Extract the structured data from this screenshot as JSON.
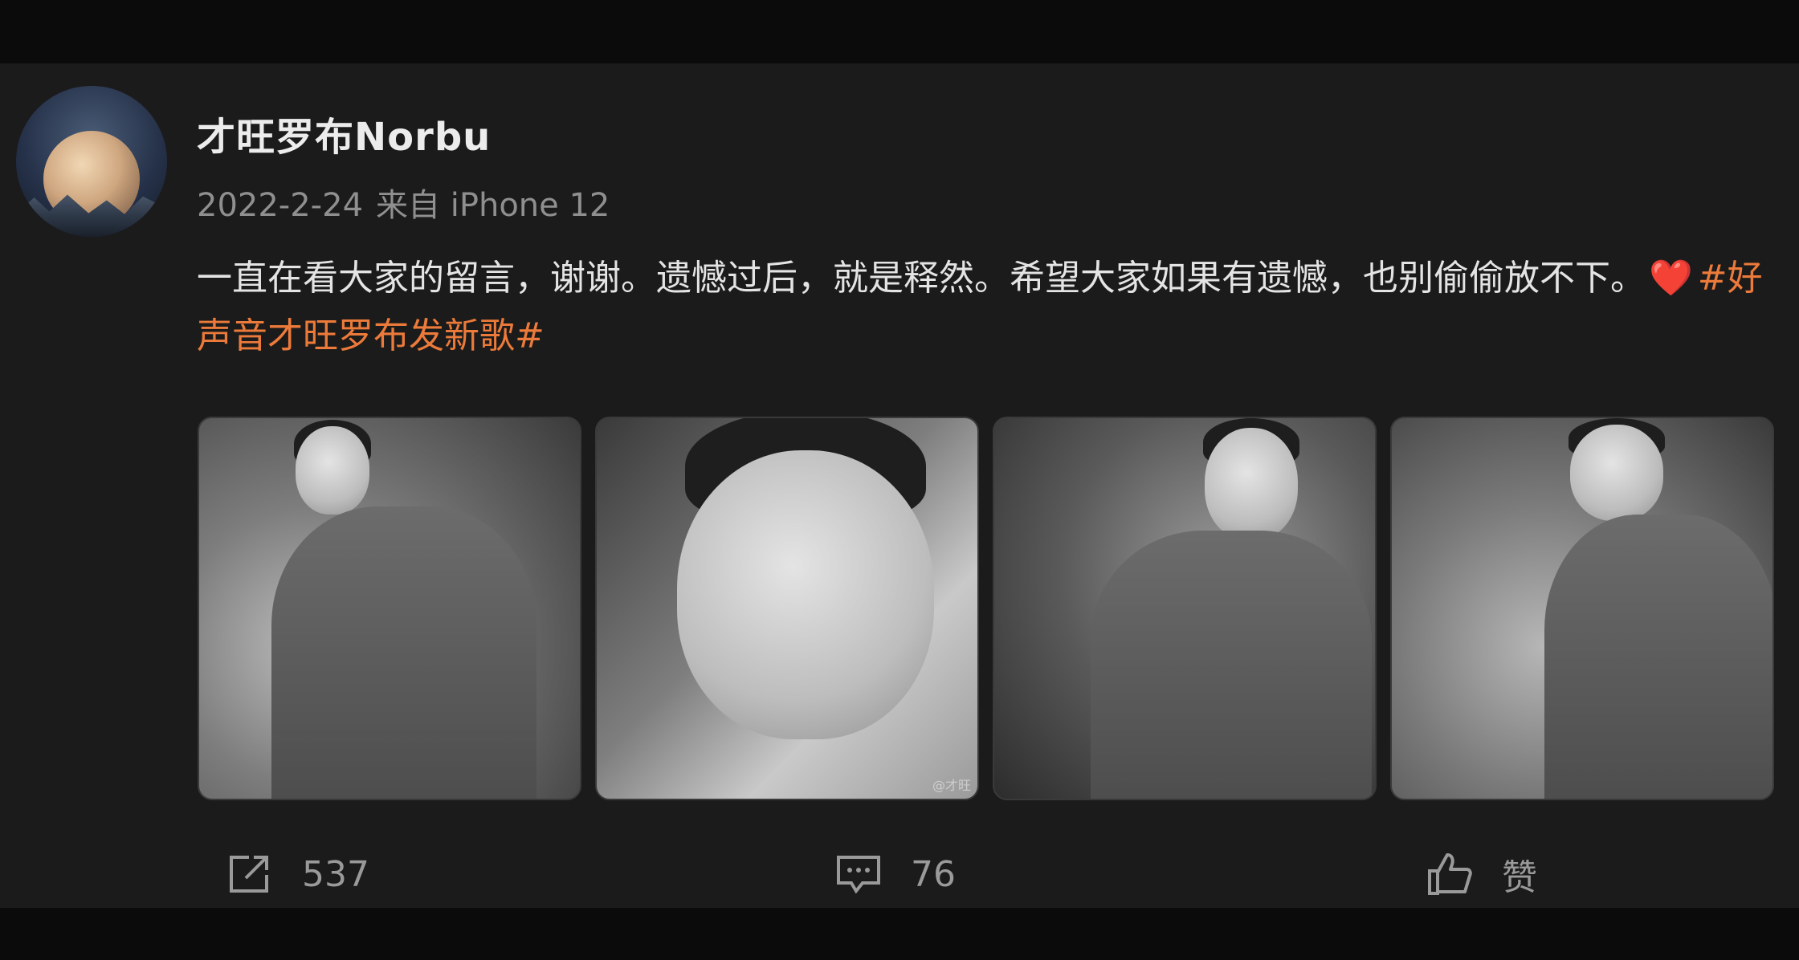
{
  "post": {
    "author": "才旺罗布Norbu",
    "date": "2022-2-24",
    "source": "来自 iPhone 12",
    "text_main": "一直在看大家的留言，谢谢。遗憾过后，就是释然。希望大家如果有遗憾，也别偷偷放不下。",
    "heart": "❤️",
    "hashtag": "#好声音才旺罗布发新歌#",
    "photo_watermark": "@才旺"
  },
  "actions": {
    "repost_count": "537",
    "comment_count": "76",
    "like_label": "赞"
  },
  "icons": {
    "repost": "share-icon",
    "comment": "comment-icon",
    "like": "thumbs-up-icon"
  },
  "colors": {
    "background": "#1b1b1b",
    "hashtag": "#ec7a3a",
    "meta_text": "#8f8f8f"
  }
}
